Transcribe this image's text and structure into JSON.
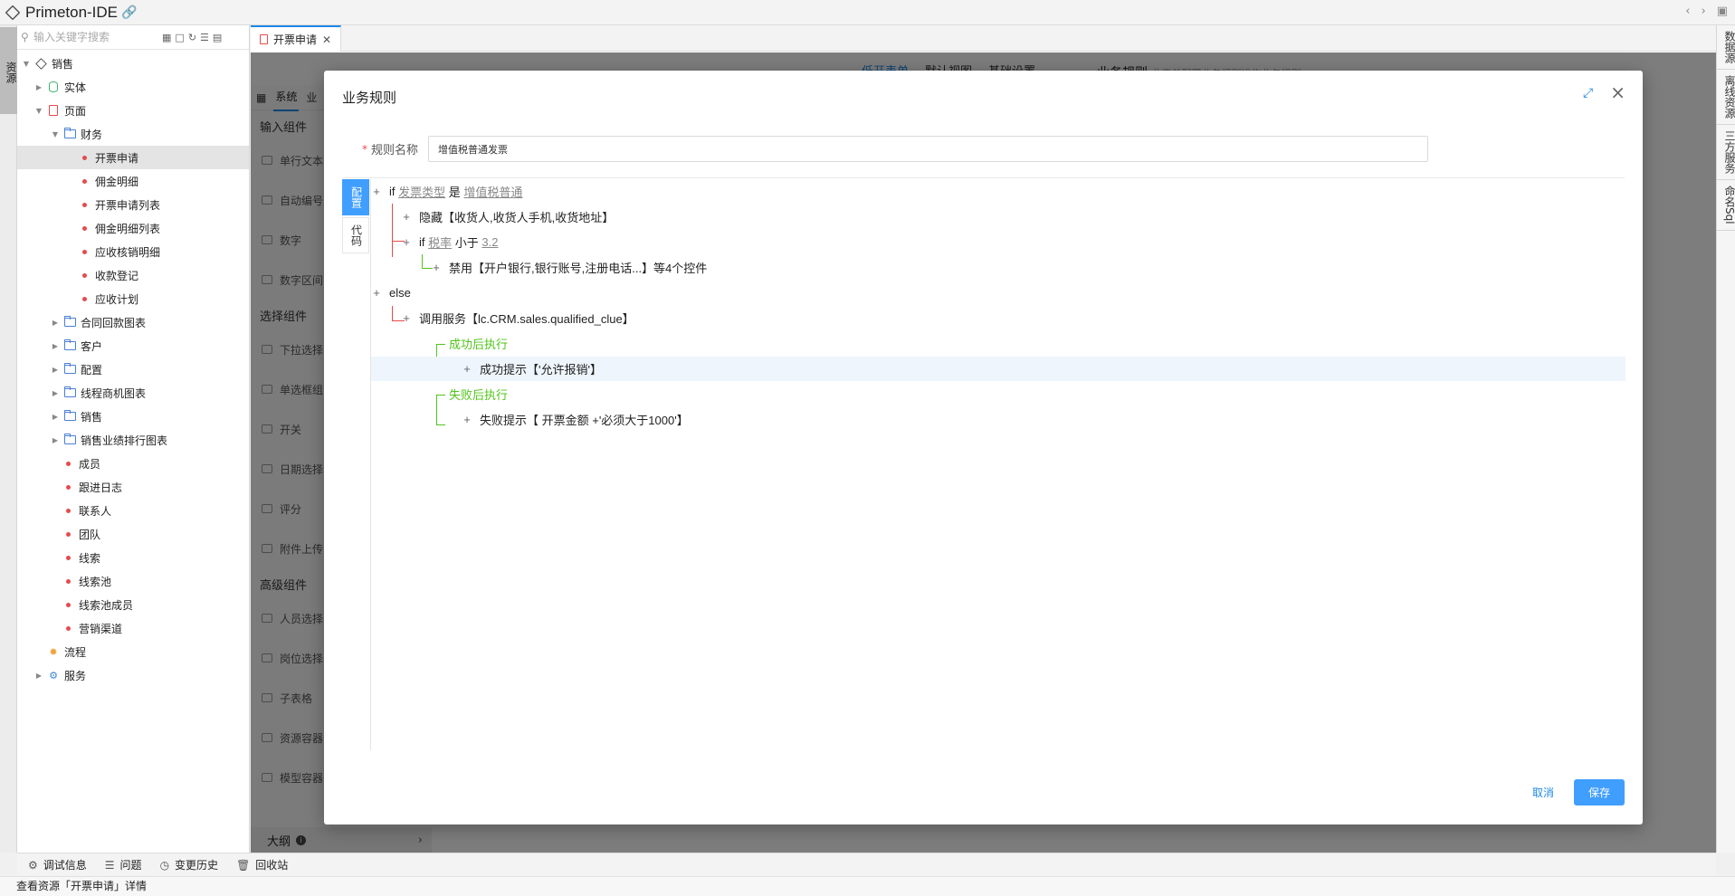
{
  "app": {
    "title": "Primeton-IDE"
  },
  "left_strip": {
    "tab_label": "资源"
  },
  "right_strip": {
    "tabs": [
      "数据源",
      "离线资源",
      "三方服务",
      "命名Sql"
    ]
  },
  "search": {
    "placeholder": "输入关键字搜索"
  },
  "tree": {
    "root": "销售",
    "entity": "实体",
    "pages": "页面",
    "finance": "财务",
    "finance_items": [
      "开票申请",
      "佣金明细",
      "开票申请列表",
      "佣金明细列表",
      "应收核销明细",
      "收款登记",
      "应收计划"
    ],
    "folders": [
      "合同回款图表",
      "客户",
      "配置",
      "线程商机图表",
      "销售",
      "销售业绩排行图表"
    ],
    "pages_items": [
      "成员",
      "跟进日志",
      "联系人",
      "团队",
      "线索",
      "线索池",
      "线索池成员",
      "营销渠道"
    ],
    "flow": "流程",
    "service": "服务"
  },
  "editor": {
    "tab_label": "开票申请",
    "subtabs": [
      "系统",
      "业"
    ],
    "sections": {
      "input": "输入组件",
      "select": "选择组件",
      "advanced": "高级组件"
    },
    "input_items": [
      "单行文本",
      "自动编号",
      "数字",
      "数字区间"
    ],
    "select_items": [
      "下拉选择",
      "单选框组",
      "开关",
      "日期选择",
      "评分",
      "附件上传"
    ],
    "advanced_items": [
      "人员选择",
      "岗位选择",
      "子表格",
      "资源容器",
      "模型容器"
    ],
    "outline": "大纲",
    "top_links": [
      "低开表单",
      "默认视图",
      "基础设置"
    ],
    "rule_head": "业务规则",
    "rule_head_sub": "此表单配置业务规则操作业务规则"
  },
  "modal": {
    "title": "业务规则",
    "name_label": "规则名称",
    "name_value": "增值税普通发票",
    "tab_config": "配置",
    "tab_code": "代码",
    "rules": {
      "if1_kw": "if",
      "if1_field": "发票类型",
      "if1_op": "是",
      "if1_value": "增值税普通",
      "hide": "隐藏【收货人,收货人手机,收货地址】",
      "if2_kw": "if",
      "if2_field": "税率",
      "if2_op": "小于",
      "if2_value": "3.2",
      "disable": "禁用【开户银行,银行账号,注册电话...】等4个控件",
      "else_kw": "else",
      "call": "调用服务【lc.CRM.sales.qualified_clue】",
      "on_success": "成功后执行",
      "success_msg": "成功提示【'允许报销'】",
      "on_fail": "失败后执行",
      "fail_msg": "失败提示【 开票金额 +'必须大于1000'】"
    },
    "cancel": "取消",
    "save": "保存"
  },
  "bottom_bar": [
    "调试信息",
    "问题",
    "变更历史",
    "回收站"
  ],
  "status": "查看资源「开票申请」详情",
  "colors": {
    "accent": "#409eff",
    "danger": "#e54b4b",
    "success": "#52c41a"
  }
}
